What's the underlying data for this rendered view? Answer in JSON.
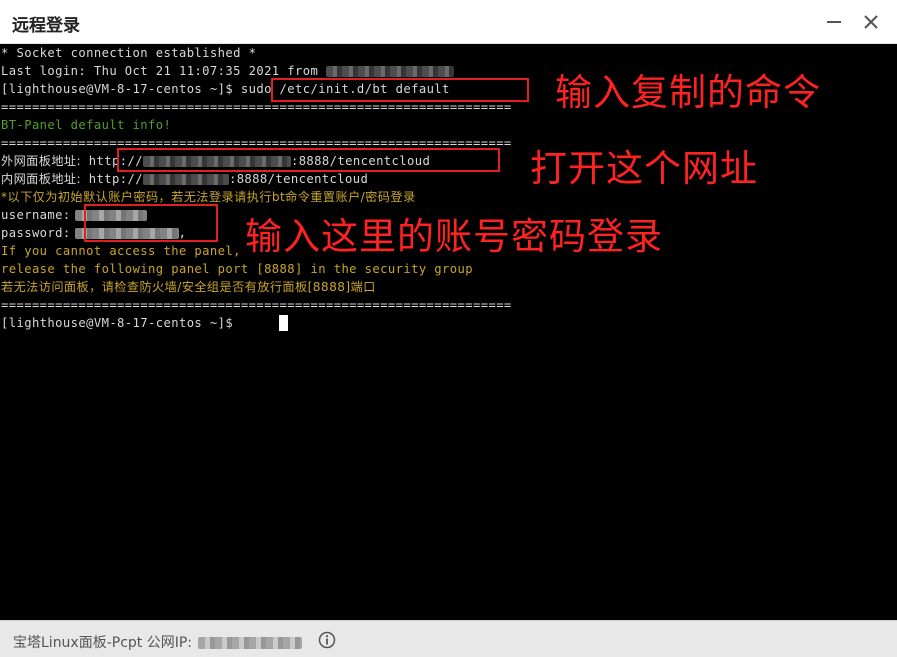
{
  "window": {
    "title": "远程登录",
    "minimize_icon": "minus-icon",
    "close_icon": "close-icon"
  },
  "terminal": {
    "lines": {
      "socket": "* Socket connection established *",
      "last_login": "Last login: Thu Oct 21 11:07:35 2021 from ",
      "prompt1": "[lighthouse@VM-8-17-centos ~]$ ",
      "command": "sudo /etc/init.d/bt default",
      "divider": "==================================================================",
      "bt_info": "BT-Panel default info!",
      "outer_label": "外网面板地址:",
      "outer_url_prefix": "http://",
      "outer_url_suffix": ":8888/tencentcloud",
      "inner_label": "内网面板地址:",
      "inner_url_prefix": "http://",
      "inner_url_suffix": ":8888/tencentcloud",
      "note": "*以下仅为初始默认账户密码，若无法登录请执行bt命令重置账户/密码登录",
      "username_label": "username:",
      "password_label": "password:",
      "password_suffix": ",",
      "warn1": "If you cannot access the panel,",
      "warn2": "release the following panel port [8888] in the security group",
      "warn3": "若无法访问面板，请检查防火墙/安全组是否有放行面板[8888]端口",
      "prompt2": "[lighthouse@VM-8-17-centos ~]$ "
    }
  },
  "annotations": {
    "copy_command": "输入复制的命令",
    "open_url": "打开这个网址",
    "login_with_account": "输入这里的账号密码登录"
  },
  "statusbar": {
    "text": "宝塔Linux面板-Pcpt 公网IP:",
    "info_icon": "info-icon"
  },
  "colors": {
    "annotation_red": "#ff2222",
    "terminal_bg": "#000000",
    "green_text": "#4ea02a",
    "yellow_text": "#c8a52a"
  }
}
